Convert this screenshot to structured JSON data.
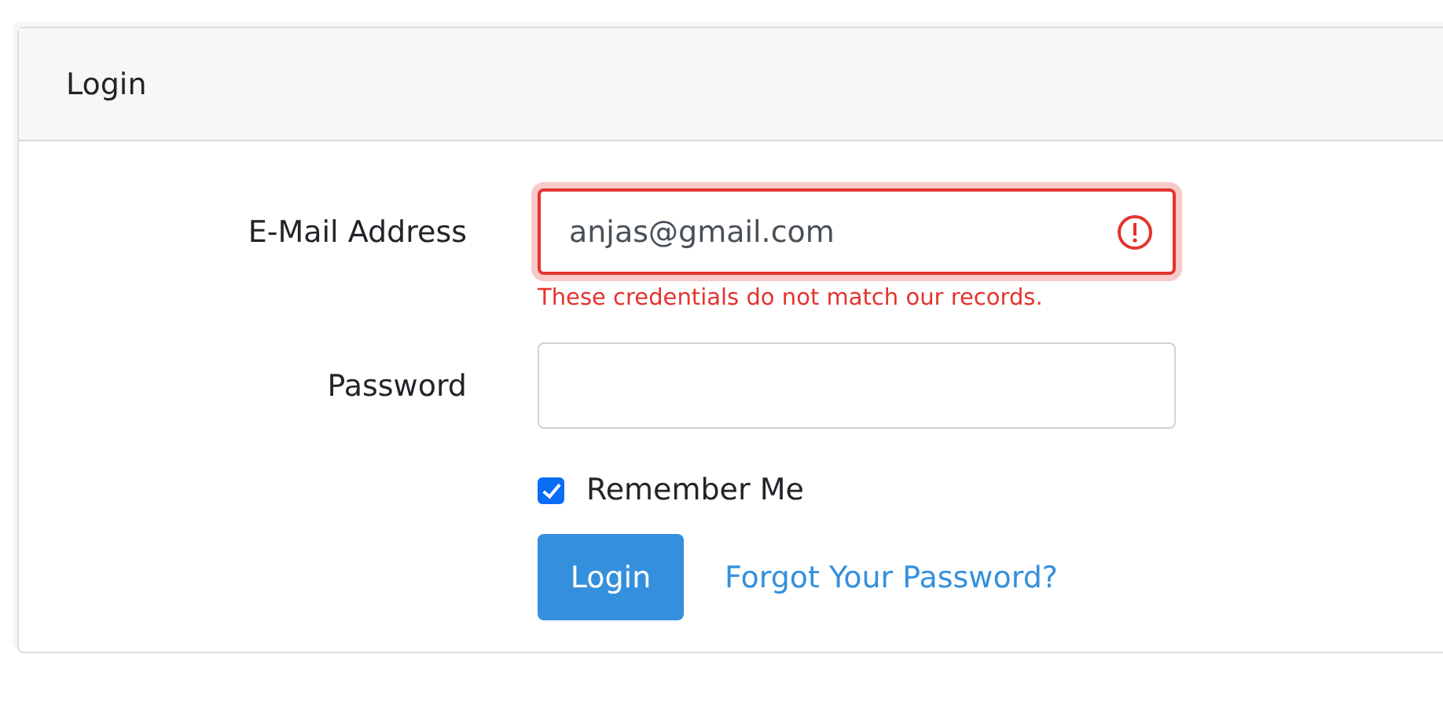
{
  "card": {
    "title": "Login"
  },
  "fields": [
    {
      "label": "E-Mail Address",
      "value": "anjas@gmail.com",
      "focused": true,
      "invalid": true,
      "error": "These credentials do not match our records."
    },
    {
      "label": "Password",
      "focused": false,
      "invalid": false
    }
  ],
  "remember": {
    "label": "Remember Me",
    "checked": true
  },
  "submit": {
    "label": "Login"
  },
  "forgot_link": {
    "label": "Forgot Your Password?"
  }
}
